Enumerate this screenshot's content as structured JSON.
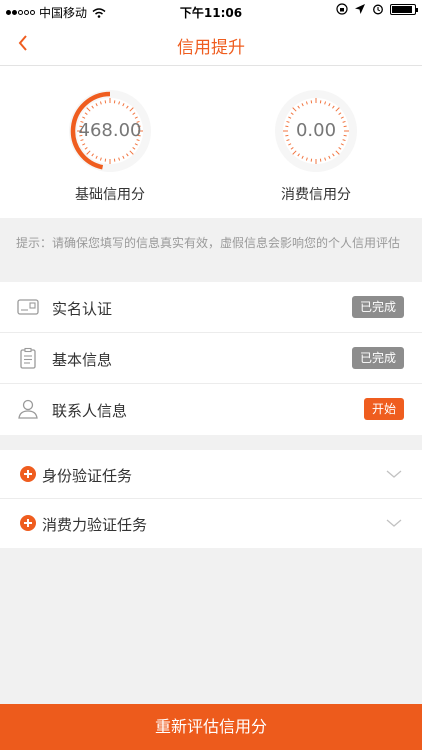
{
  "status_bar": {
    "carrier": "中国移动",
    "time": "下午11:06"
  },
  "nav": {
    "title": "信用提升"
  },
  "scores": {
    "basic": {
      "value": "468.00",
      "label": "基础信用分",
      "fraction": 0.468
    },
    "consume": {
      "value": "0.00",
      "label": "消费信用分",
      "fraction": 0.0
    }
  },
  "tip": "提示：请确保您填写的信息真实有效，虚假信息会影响您的个人信用评估",
  "items": [
    {
      "label": "实名认证",
      "badge": "已完成",
      "icon": "id-card-icon"
    },
    {
      "label": "基本信息",
      "badge": "已完成",
      "icon": "clipboard-icon"
    },
    {
      "label": "联系人信息",
      "badge": "开始",
      "icon": "person-icon"
    }
  ],
  "tasks": [
    {
      "label": "身份验证任务"
    },
    {
      "label": "消费力验证任务"
    }
  ],
  "bottom_button": "重新评估信用分",
  "colors": {
    "accent": "#ef5d1f",
    "done_badge": "#8d8d8d",
    "background": "#f1f1f1"
  }
}
